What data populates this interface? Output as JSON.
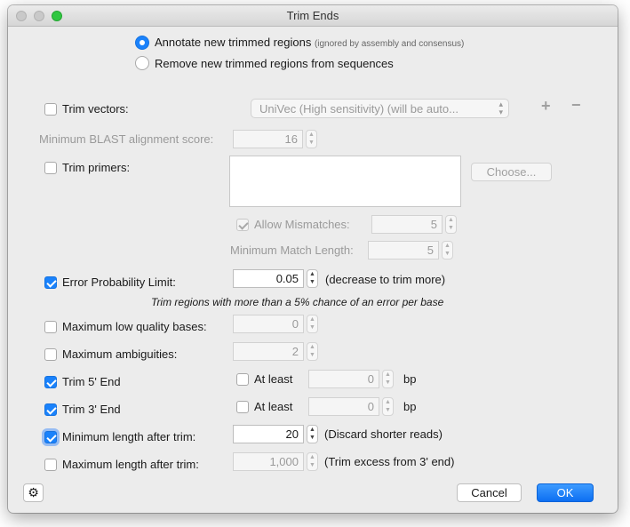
{
  "window": {
    "title": "Trim Ends"
  },
  "annotate_option": {
    "label": "Annotate new trimmed regions",
    "hint": "(ignored by assembly and consensus)",
    "selected": true
  },
  "remove_option": {
    "label": "Remove new trimmed regions from sequences",
    "selected": false
  },
  "trim_vectors": {
    "label": "Trim vectors:",
    "checked": false,
    "database": "UniVec (High sensitivity) (will be auto...",
    "add_symbol": "+",
    "remove_symbol": "−"
  },
  "blast_score": {
    "label": "Minimum BLAST alignment score:",
    "value": "16"
  },
  "trim_primers": {
    "label": "Trim primers:",
    "checked": false,
    "choose_label": "Choose...",
    "allow_mismatches_label": "Allow Mismatches:",
    "allow_mismatches_checked": true,
    "mismatches_value": "5",
    "min_match_label": "Minimum Match Length:",
    "min_match_value": "5"
  },
  "error_prob": {
    "label": "Error Probability Limit:",
    "checked": true,
    "value": "0.05",
    "note": "(decrease to trim more)",
    "explanation": "Trim regions with more than a 5% chance of an error per base"
  },
  "max_low_quality": {
    "label": "Maximum low quality bases:",
    "checked": false,
    "value": "0"
  },
  "max_ambiguities": {
    "label": "Maximum ambiguities:",
    "checked": false,
    "value": "2"
  },
  "trim5": {
    "label": "Trim 5' End",
    "checked": true,
    "at_least_label": "At least",
    "at_least_checked": false,
    "value": "0",
    "unit": "bp"
  },
  "trim3": {
    "label": "Trim 3' End",
    "checked": true,
    "at_least_label": "At least",
    "at_least_checked": false,
    "value": "0",
    "unit": "bp"
  },
  "min_length": {
    "label": "Minimum length after trim:",
    "checked": true,
    "value": "20",
    "note": "(Discard shorter reads)"
  },
  "max_length": {
    "label": "Maximum length after trim:",
    "checked": false,
    "value": "1,000",
    "note": "(Trim excess from 3' end)"
  },
  "footer": {
    "cancel_label": "Cancel",
    "ok_label": "OK",
    "gear_symbol": "⚙"
  },
  "stepper": {
    "up": "▲",
    "down": "▼"
  },
  "colors": {
    "accent": "#1a82fb",
    "window_bg": "#ececec"
  }
}
